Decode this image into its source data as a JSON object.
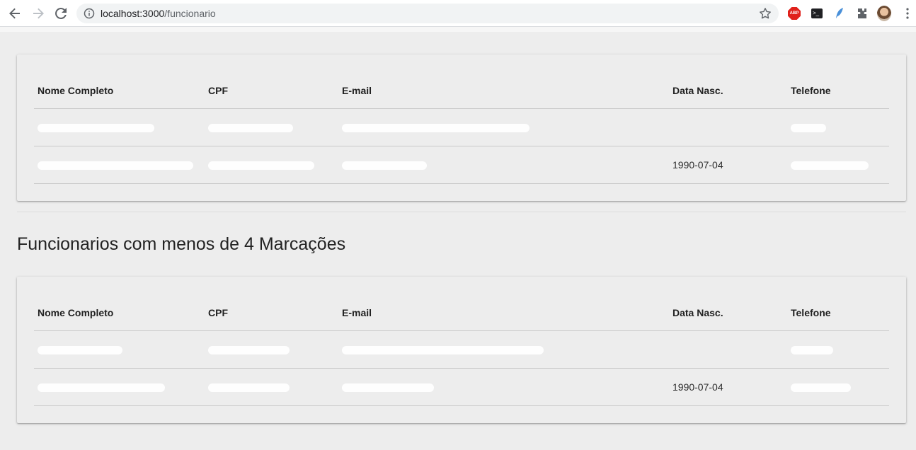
{
  "browser": {
    "url_host": "localhost:3000",
    "url_path": "/funcionario",
    "extensions": [
      "abp-extension-icon",
      "terminal-extension-icon",
      "feather-extension-icon",
      "puzzle-extensions-icon",
      "profile-avatar"
    ]
  },
  "table_headers": {
    "name": "Nome Completo",
    "cpf": "CPF",
    "email": "E-mail",
    "birth": "Data Nasc.",
    "phone": "Telefone"
  },
  "table_all": {
    "rows": [
      {
        "name": "",
        "cpf": "",
        "email": "",
        "birth": "",
        "phone": ""
      },
      {
        "name": "",
        "cpf": "",
        "email": "",
        "birth": "1990-07-04",
        "phone": ""
      }
    ]
  },
  "section_title": "Funcionarios com menos de 4 Marcações",
  "table_few": {
    "rows": [
      {
        "name": "",
        "cpf": "",
        "email": "",
        "birth": "",
        "phone": ""
      },
      {
        "name": "",
        "cpf": "",
        "email": "",
        "birth": "1990-07-04",
        "phone": ""
      }
    ]
  },
  "colors": {
    "page_bg": "#ededed",
    "redaction": "#ffffff",
    "abp_red": "#e0211b"
  }
}
